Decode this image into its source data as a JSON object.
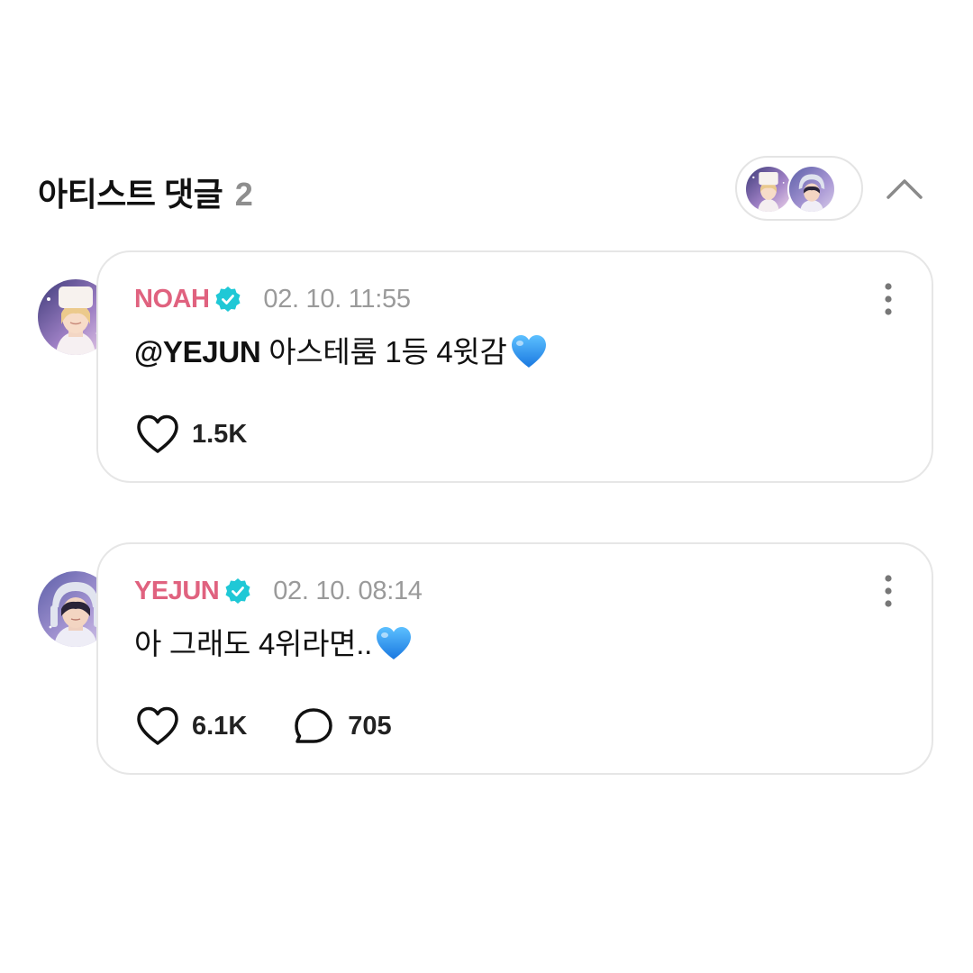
{
  "header": {
    "title": "아티스트 댓글",
    "count": "2"
  },
  "icons": {
    "collapse": "chevron-up-icon",
    "verified": "verified-badge-icon",
    "more": "more-vertical-icon",
    "like": "heart-outline-icon",
    "reply": "comment-bubble-icon",
    "emoji": "blue-heart-emoji"
  },
  "colors": {
    "author": "#e0627f",
    "verified": "#1fc8d6",
    "timestamp": "#9a9a9a",
    "card_border": "#e6e6e6",
    "emoji_heart": "#1e8ef0"
  },
  "comments": [
    {
      "author": "NOAH",
      "time": "02. 10. 11:55",
      "mention": "@YEJUN",
      "text": " 아스테룸 1등 4윗감",
      "likes": "1.5K"
    },
    {
      "author": "YEJUN",
      "time": "02. 10. 08:14",
      "text": "아 그래도 4위라면..",
      "likes": "6.1K",
      "replies": "705"
    }
  ]
}
